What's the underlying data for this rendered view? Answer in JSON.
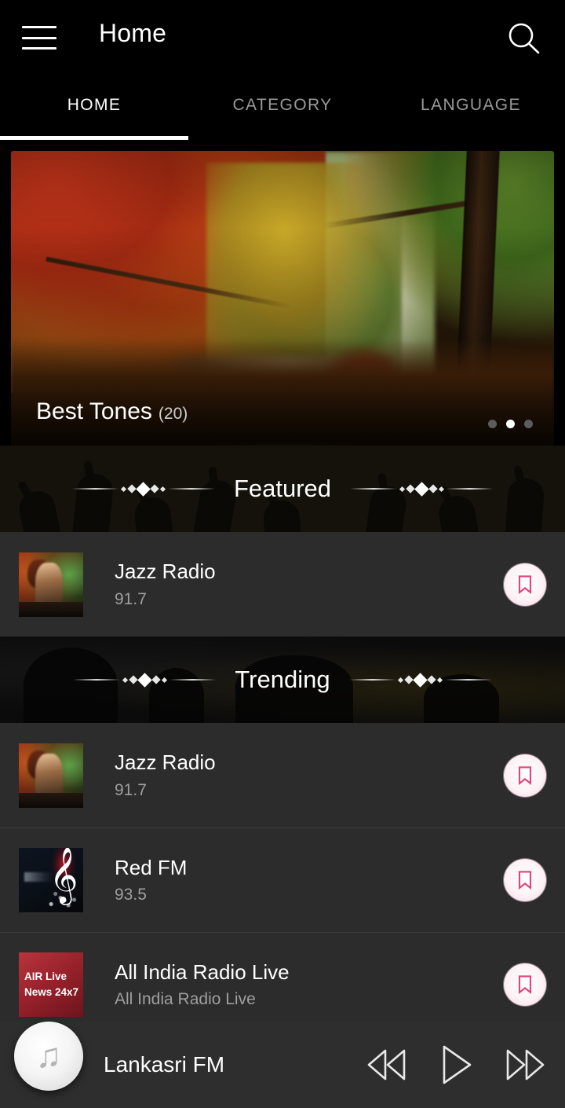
{
  "appbar": {
    "menu_icon": "hamburger-menu-icon",
    "title": "Home",
    "search_icon": "search-icon"
  },
  "tabs": [
    {
      "label": "HOME",
      "active": true
    },
    {
      "label": "CATEGORY",
      "active": false
    },
    {
      "label": "LANGUAGE",
      "active": false
    }
  ],
  "banner": {
    "title": "Best Tones",
    "count": "(20)",
    "dots_total": 3,
    "dots_active_index": 1
  },
  "sections": {
    "featured": {
      "title": "Featured"
    },
    "trending": {
      "title": "Trending"
    }
  },
  "featured_items": [
    {
      "title": "Jazz Radio",
      "subtitle": "91.7",
      "thumb": "jazz-dj-artwork",
      "bookmark_icon": "bookmark-icon"
    }
  ],
  "trending_items": [
    {
      "title": "Jazz Radio",
      "subtitle": "91.7",
      "thumb": "jazz-dj-artwork",
      "bookmark_icon": "bookmark-icon"
    },
    {
      "title": "Red FM",
      "subtitle": "93.5",
      "thumb": "treble-clef-artwork",
      "bookmark_icon": "bookmark-icon"
    },
    {
      "title": "All India Radio Live",
      "subtitle": "All India Radio Live",
      "thumb": "air-live-artwork",
      "thumb_line1": "AIR Live",
      "thumb_line2": "News 24x7",
      "bookmark_icon": "bookmark-icon"
    }
  ],
  "player": {
    "art_icon": "music-note-icon",
    "title": "Lankasri FM",
    "prev_icon": "rewind-icon",
    "play_icon": "play-icon",
    "next_icon": "fast-forward-icon"
  },
  "colors": {
    "background": "#000000",
    "row_background": "#2c2c2c",
    "player_background": "#2e2e2e",
    "accent_pink": "#e0457b",
    "text_primary": "#ffffff",
    "text_secondary": "#9e9e9e",
    "tab_inactive": "#9a9a9a"
  }
}
